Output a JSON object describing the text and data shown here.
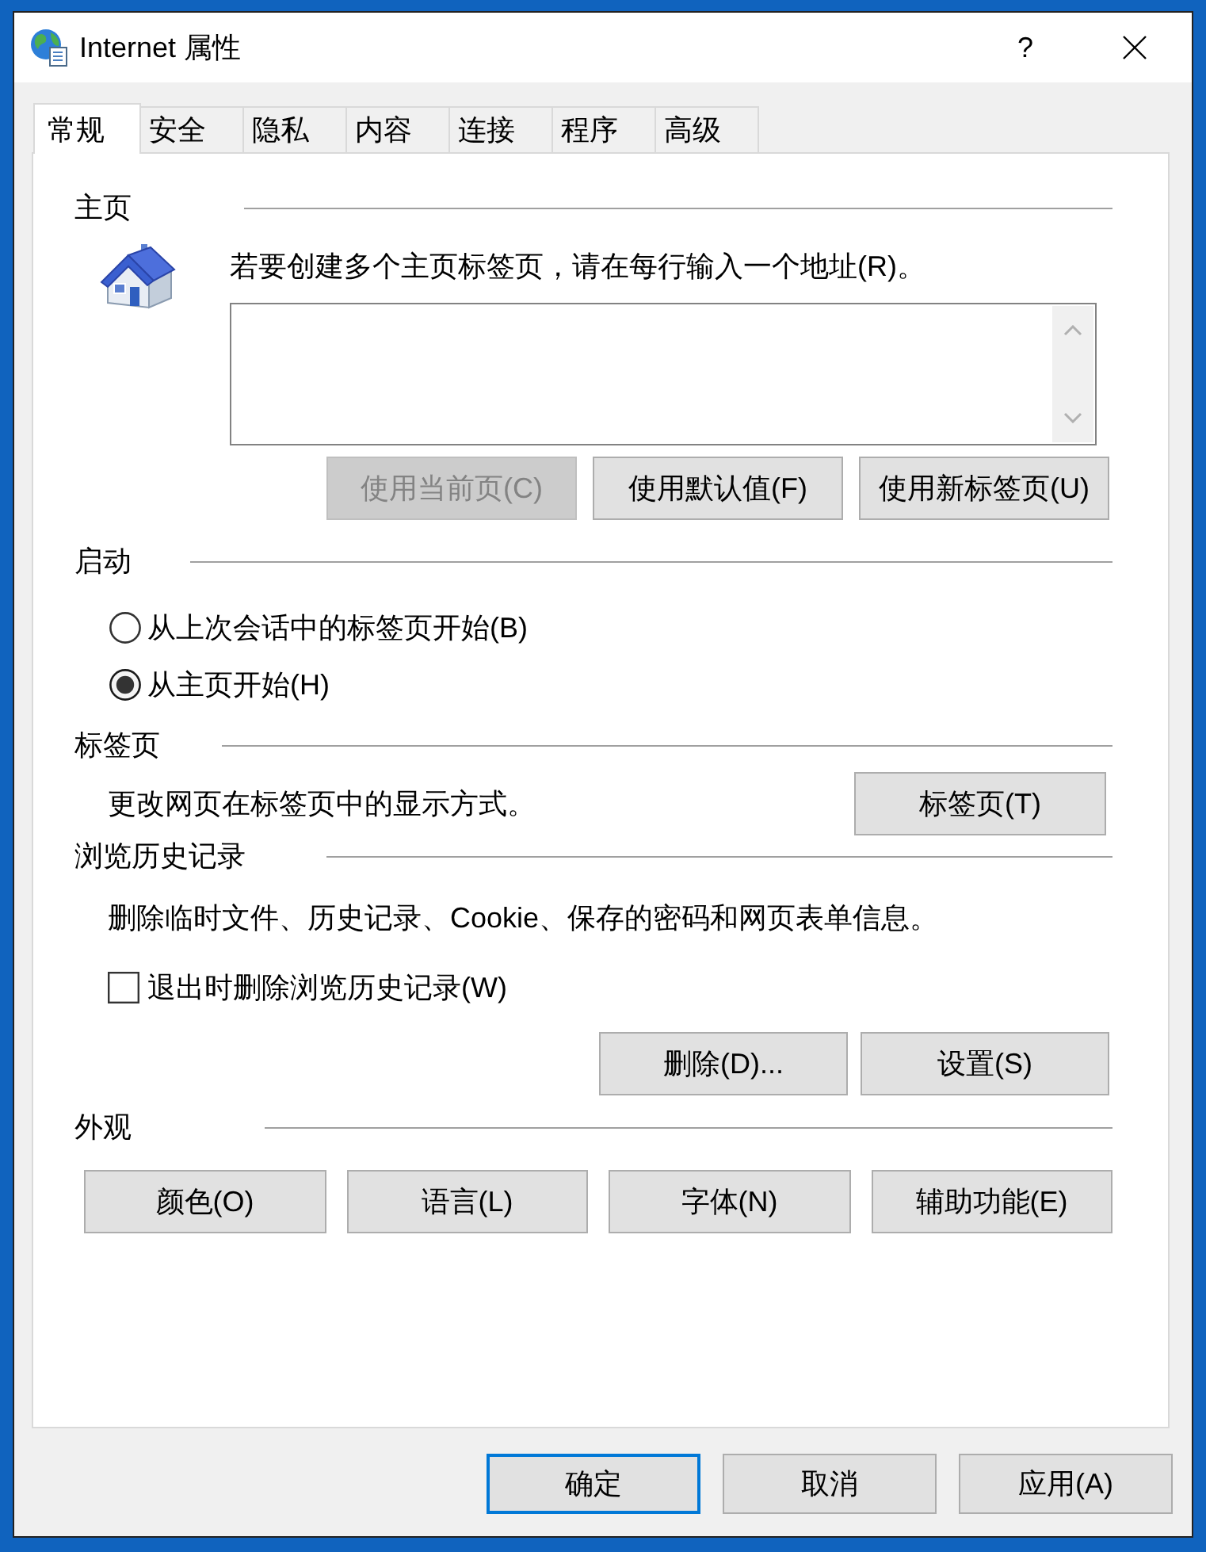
{
  "window": {
    "title": "Internet 属性",
    "help_button": "?"
  },
  "tabs": [
    {
      "label": "常规",
      "selected": true
    },
    {
      "label": "安全",
      "selected": false
    },
    {
      "label": "隐私",
      "selected": false
    },
    {
      "label": "内容",
      "selected": false
    },
    {
      "label": "连接",
      "selected": false
    },
    {
      "label": "程序",
      "selected": false
    },
    {
      "label": "高级",
      "selected": false
    }
  ],
  "sections": [
    {
      "kind": "home",
      "title": "主页",
      "hint": "若要创建多个主页标签页，请在每行输入一个地址(R)。",
      "buttons": [
        {
          "label": "使用当前页(C)",
          "disabled": true
        },
        {
          "label": "使用默认值(F)",
          "disabled": false
        },
        {
          "label": "使用新标签页(U)",
          "disabled": false
        }
      ]
    },
    {
      "kind": "startup",
      "title": "启动",
      "options": [
        {
          "label": "从上次会话中的标签页开始(B)",
          "selected": false
        },
        {
          "label": "从主页开始(H)",
          "selected": true
        }
      ]
    },
    {
      "kind": "tabs",
      "title": "标签页",
      "description": "更改网页在标签页中的显示方式。",
      "buttons": [
        {
          "label": "标签页(T)",
          "disabled": false
        }
      ]
    },
    {
      "kind": "history",
      "title": "浏览历史记录",
      "description": "删除临时文件、历史记录、Cookie、保存的密码和网页表单信息。",
      "checkbox": {
        "label": "退出时删除浏览历史记录(W)",
        "checked": false
      },
      "buttons": [
        {
          "label": "删除(D)...",
          "disabled": false
        },
        {
          "label": "设置(S)",
          "disabled": false
        }
      ]
    },
    {
      "kind": "appearance",
      "title": "外观",
      "buttons": [
        {
          "label": "颜色(O)",
          "disabled": false
        },
        {
          "label": "语言(L)",
          "disabled": false
        },
        {
          "label": "字体(N)",
          "disabled": false
        },
        {
          "label": "辅助功能(E)",
          "disabled": false
        }
      ]
    }
  ],
  "footer_buttons": [
    {
      "label": "确定",
      "focused": true
    },
    {
      "label": "取消",
      "focused": false
    },
    {
      "label": "应用(A)",
      "focused": false
    }
  ]
}
